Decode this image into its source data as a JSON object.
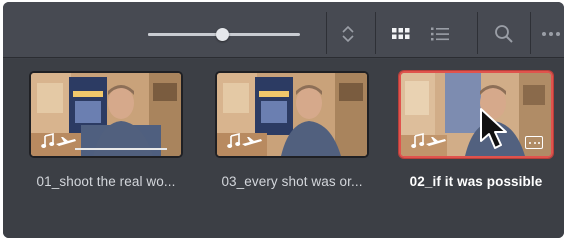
{
  "toolbar": {
    "zoom_slider": {
      "value": 0.49
    },
    "icons": [
      "sort-icon",
      "grid-view-icon",
      "list-view-icon",
      "search-icon",
      "more-icon"
    ]
  },
  "clips": [
    {
      "label": "01_shoot the real wo...",
      "selected": false,
      "has_audio": true,
      "show_progress": true
    },
    {
      "label": "03_every shot was or...",
      "selected": false,
      "has_audio": true,
      "show_progress": false
    },
    {
      "label": "02_if it was possible",
      "selected": true,
      "has_audio": true,
      "show_progress": false
    }
  ],
  "colors": {
    "panel_bg": "#3e4148",
    "toolbar_bg": "#474a52",
    "selection": "#e0534d",
    "label": "#d3d6db"
  }
}
